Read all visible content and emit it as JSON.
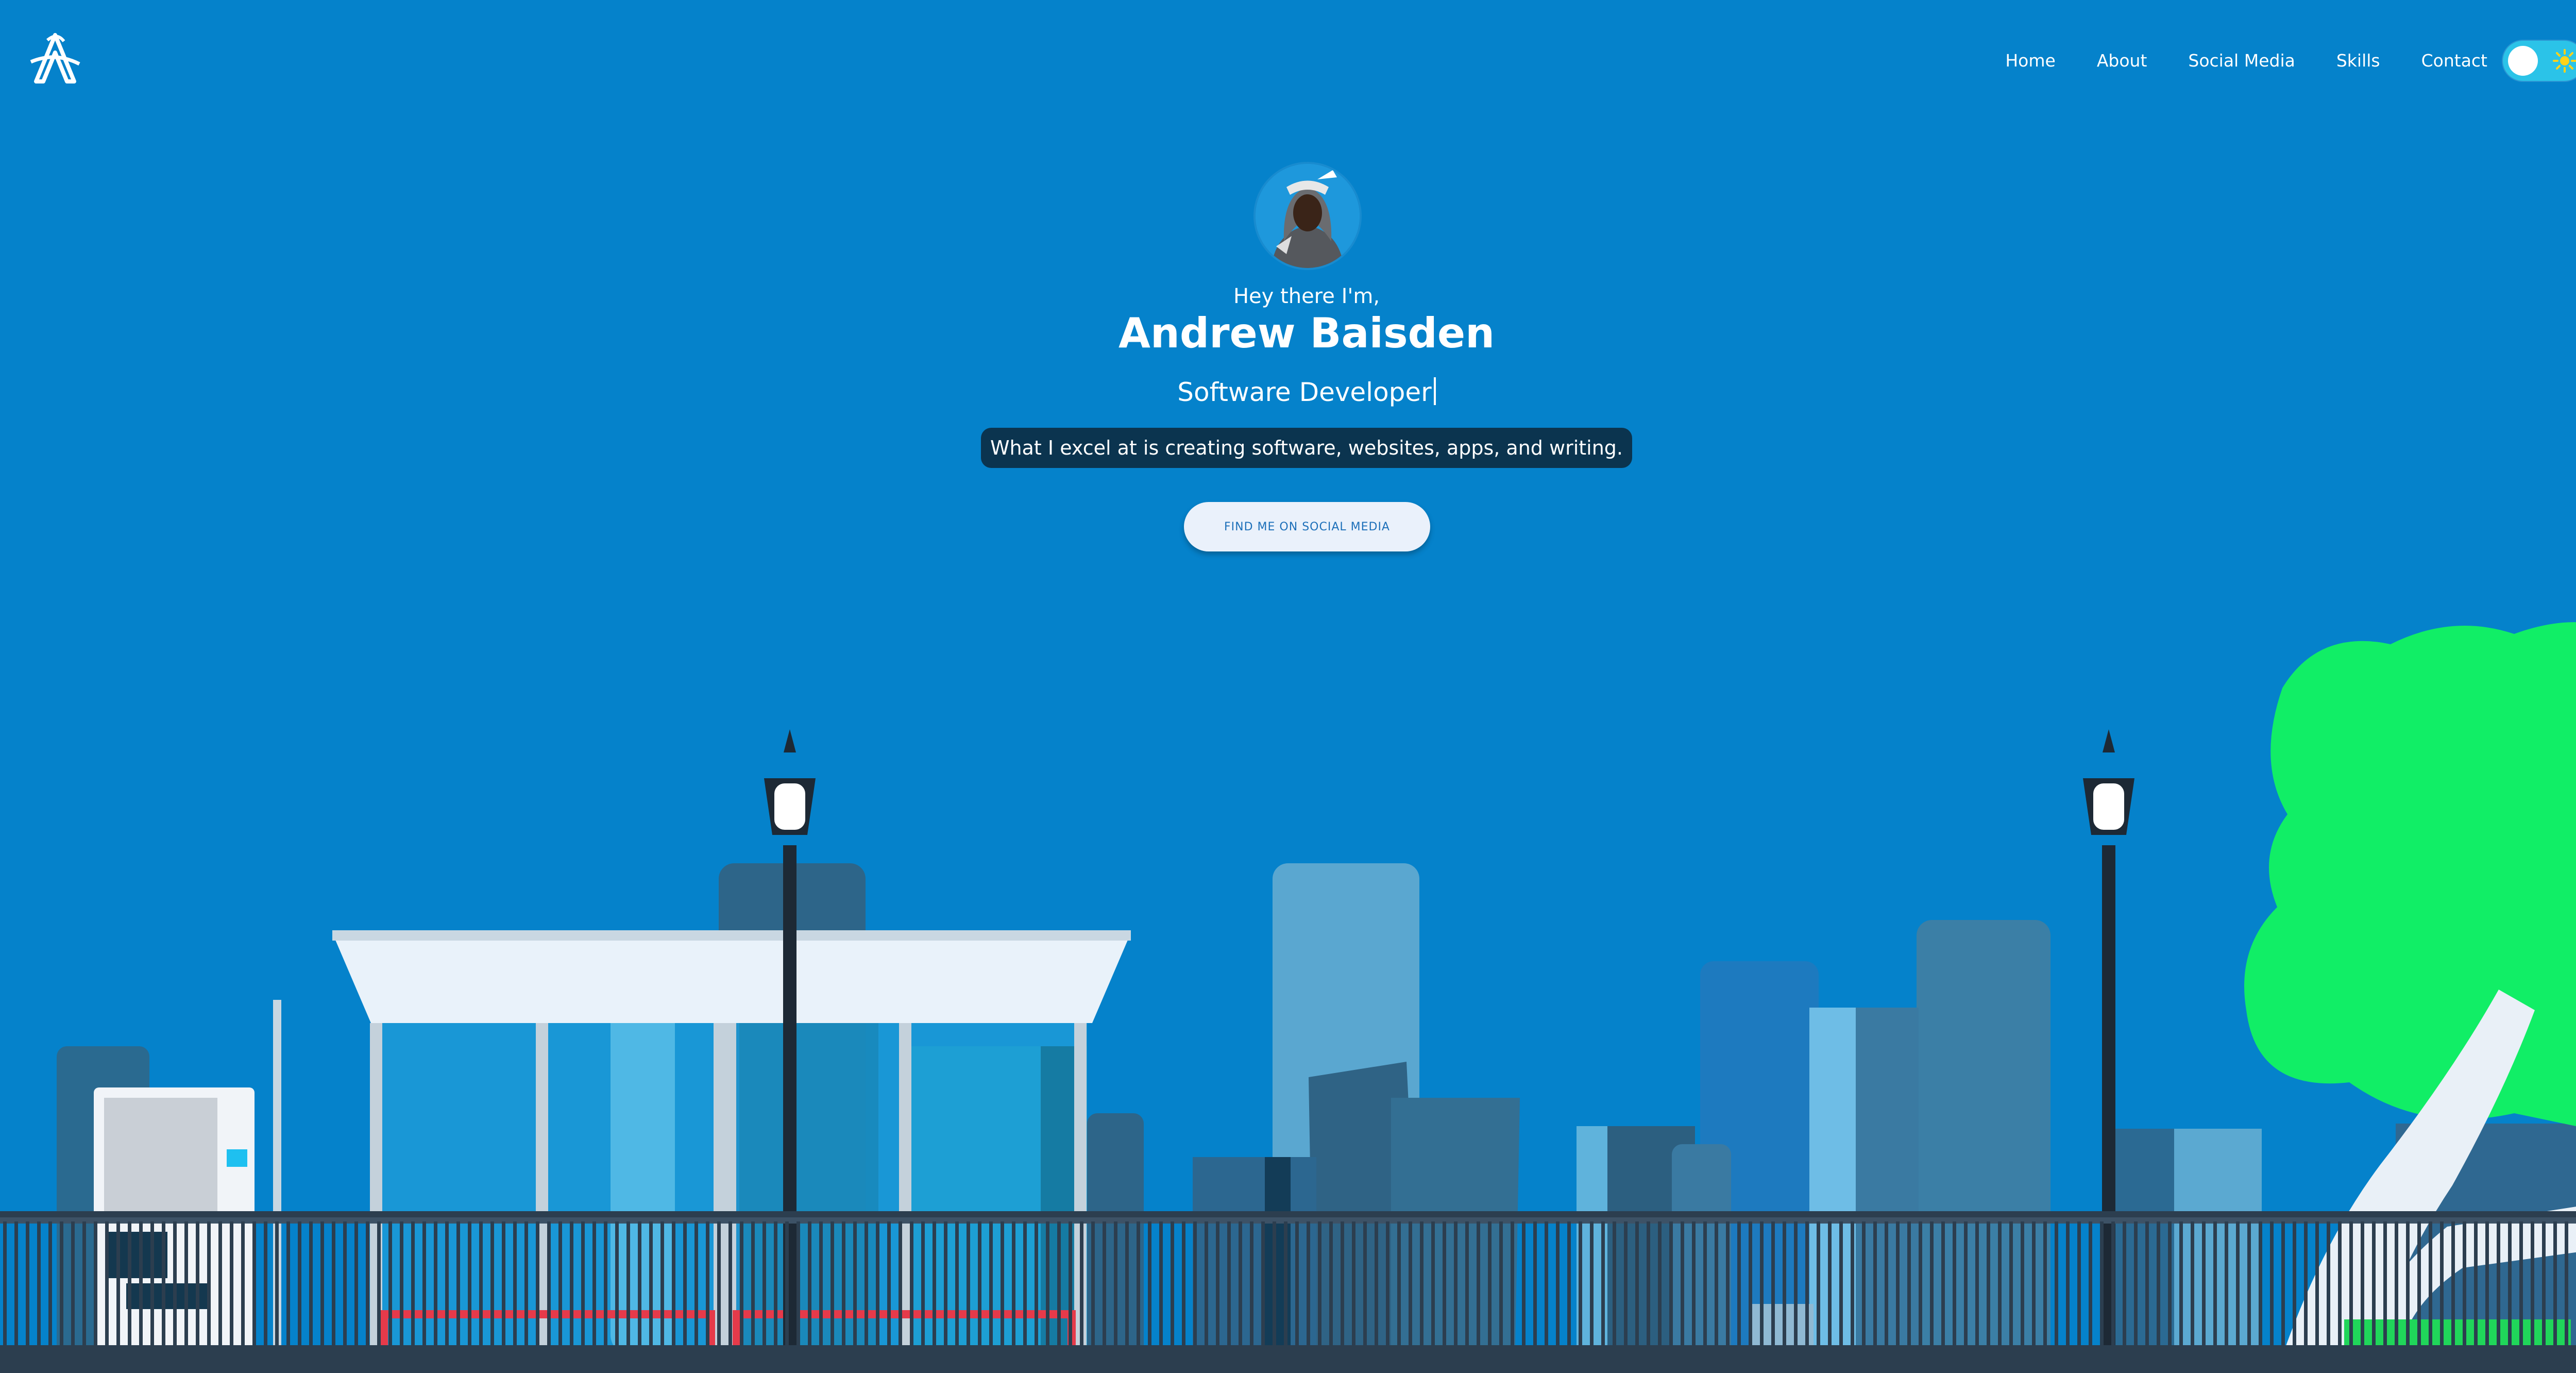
{
  "header": {
    "logo_icon": "stylized-A-logo",
    "nav": [
      "Home",
      "About",
      "Social Media",
      "Skills",
      "Contact"
    ],
    "theme_toggle": {
      "state": "light",
      "icon": "sun-icon"
    }
  },
  "hero": {
    "greeting": "Hey there I'm,",
    "name": "Andrew Baisden",
    "role": "Software Developer",
    "tagline": "What I excel at is creating software, websites, apps, and writing.",
    "cta_label": "FIND ME ON SOCIAL MEDIA"
  },
  "colors": {
    "background": "#0582cb",
    "tagline_bg": "#0b344f",
    "toggle": "#2bc3e8",
    "tree": "#11ee66",
    "fence": "#2c3e4f"
  }
}
